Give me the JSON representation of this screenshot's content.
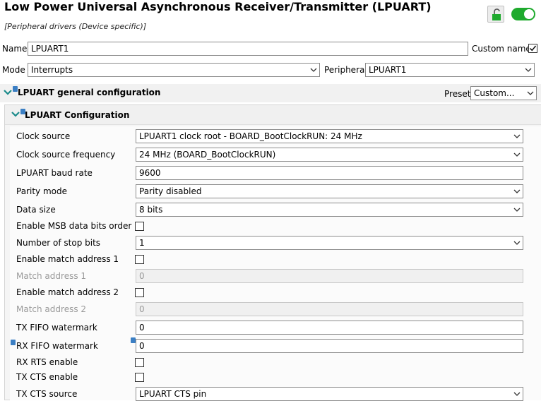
{
  "header": {
    "title": "Low Power Universal Asynchronous Receiver/Transmitter (LPUART)",
    "subtitle": "[Peripheral drivers (Device specific)]"
  },
  "top": {
    "name_label": "Name",
    "name_value": "LPUART1",
    "custom_name_label": "Custom name",
    "custom_name_checked": true,
    "mode_label": "Mode",
    "mode_value": "Interrupts",
    "peripheral_label": "Peripheral",
    "peripheral_value": "LPUART1"
  },
  "general": {
    "title": "LPUART general configuration",
    "preset_label": "Preset",
    "preset_value": "Custom..."
  },
  "config": {
    "title": "LPUART Configuration",
    "rows": [
      {
        "label": "Clock source",
        "type": "select",
        "value": "LPUART1 clock root - BOARD_BootClockRUN: 24 MHz"
      },
      {
        "label": "Clock source frequency",
        "type": "select",
        "value": "24 MHz (BOARD_BootClockRUN)"
      },
      {
        "label": "LPUART baud rate",
        "type": "text",
        "value": "9600"
      },
      {
        "label": "Parity mode",
        "type": "select",
        "value": "Parity disabled"
      },
      {
        "label": "Data size",
        "type": "select",
        "value": "8 bits"
      },
      {
        "label": "Enable MSB data bits order",
        "type": "checkbox",
        "checked": false
      },
      {
        "label": "Number of stop bits",
        "type": "select",
        "value": "1"
      },
      {
        "label": "Enable match address 1",
        "type": "checkbox",
        "checked": false
      },
      {
        "label": "Match address 1",
        "type": "text",
        "value": "0",
        "disabled": true
      },
      {
        "label": "Enable match address 2",
        "type": "checkbox",
        "checked": false
      },
      {
        "label": "Match address 2",
        "type": "text",
        "value": "0",
        "disabled": true
      },
      {
        "label": "TX FIFO watermark",
        "type": "text",
        "value": "0"
      },
      {
        "label": "RX FIFO watermark",
        "type": "text",
        "value": "0"
      },
      {
        "label": "RX RTS enable",
        "type": "checkbox",
        "checked": false
      },
      {
        "label": "TX CTS enable",
        "type": "checkbox",
        "checked": false
      },
      {
        "label": "TX CTS source",
        "type": "select",
        "value": "LPUART CTS pin"
      }
    ]
  },
  "colors": {
    "toggle_on": "#1faa2e",
    "chevron": "#1a8a8a",
    "info_badge": "#3b7fc4"
  }
}
